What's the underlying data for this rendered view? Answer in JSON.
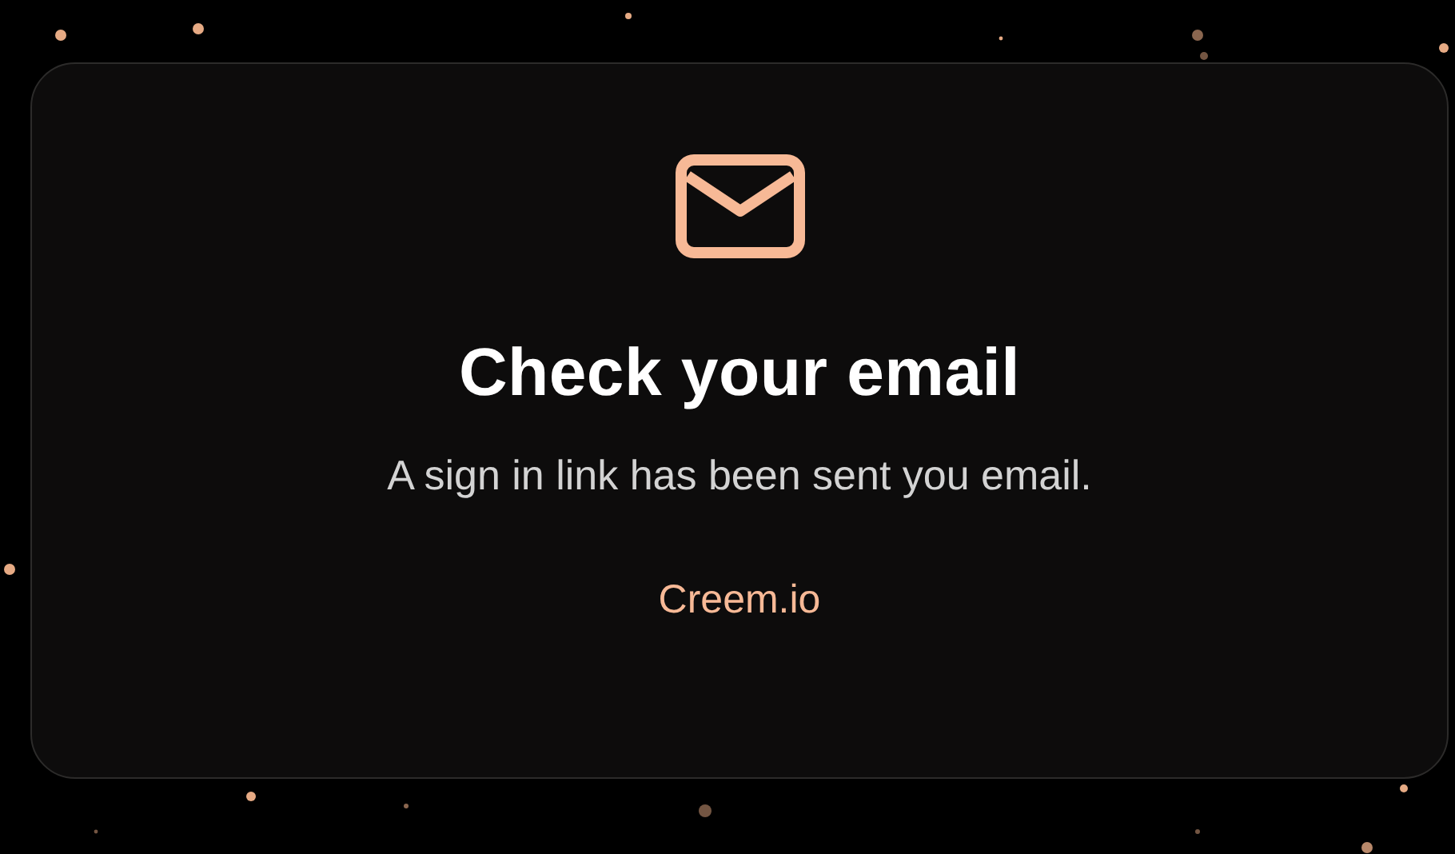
{
  "title": "Check your email",
  "message": "A sign in link has been sent you email.",
  "link": "Creem.io"
}
